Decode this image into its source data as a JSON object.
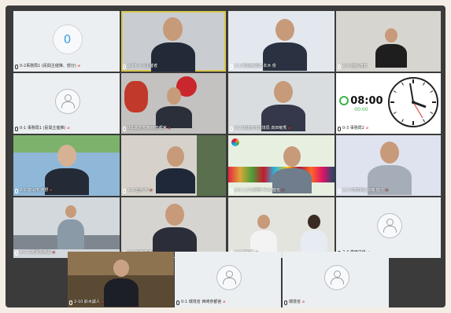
{
  "timer": {
    "count": "0",
    "digital": "08:00",
    "sub": "00:00"
  },
  "tiles": [
    {
      "name": "o-2-office-counter",
      "label": "0-2事務局1 (民間主催推、部分)"
    },
    {
      "name": "video-host-speaker",
      "label": "2-7キャ令主催者"
    },
    {
      "name": "video-2-1",
      "label": "2-1 新潟県消防 本木 俊"
    },
    {
      "name": "video-2-4",
      "label": "2-4 加賀 雅宏"
    },
    {
      "name": "o-1-office",
      "label": "0-1 事務局1 (民間主催推)"
    },
    {
      "name": "video-0-1",
      "label": "0-1環境省 西崎奈都宮"
    },
    {
      "name": "video-0-2",
      "label": "0-2 環境省市環境局 高田敏秀"
    },
    {
      "name": "clock-tile",
      "label": "0-3 事務局2"
    },
    {
      "name": "video-2-2",
      "label": "2-2 富山市 河野"
    },
    {
      "name": "video-1-2",
      "label": "1-2 岩野 秀"
    },
    {
      "name": "video-2-3",
      "label": "2-3 こども港市 片山 健也"
    },
    {
      "name": "video-2-1b",
      "label": "2-1 竹熊市長 齋藤 健次"
    },
    {
      "name": "video-2-5",
      "label": "2-5 三宅幸原県長"
    },
    {
      "name": "video-2-6",
      "label": "2-2 吉峰 秀樹"
    },
    {
      "name": "video-2-4b",
      "label": "2-4 加賀市"
    },
    {
      "name": "avatar-2-4",
      "label": "2-4 森田由佳"
    },
    {
      "name": "video-2-10",
      "label": "2-10 鈴木誠人"
    },
    {
      "name": "avatar-0-1",
      "label": "0-1 環境省 西崎奈都宮"
    },
    {
      "name": "avatar-env",
      "label": "環境省"
    }
  ]
}
